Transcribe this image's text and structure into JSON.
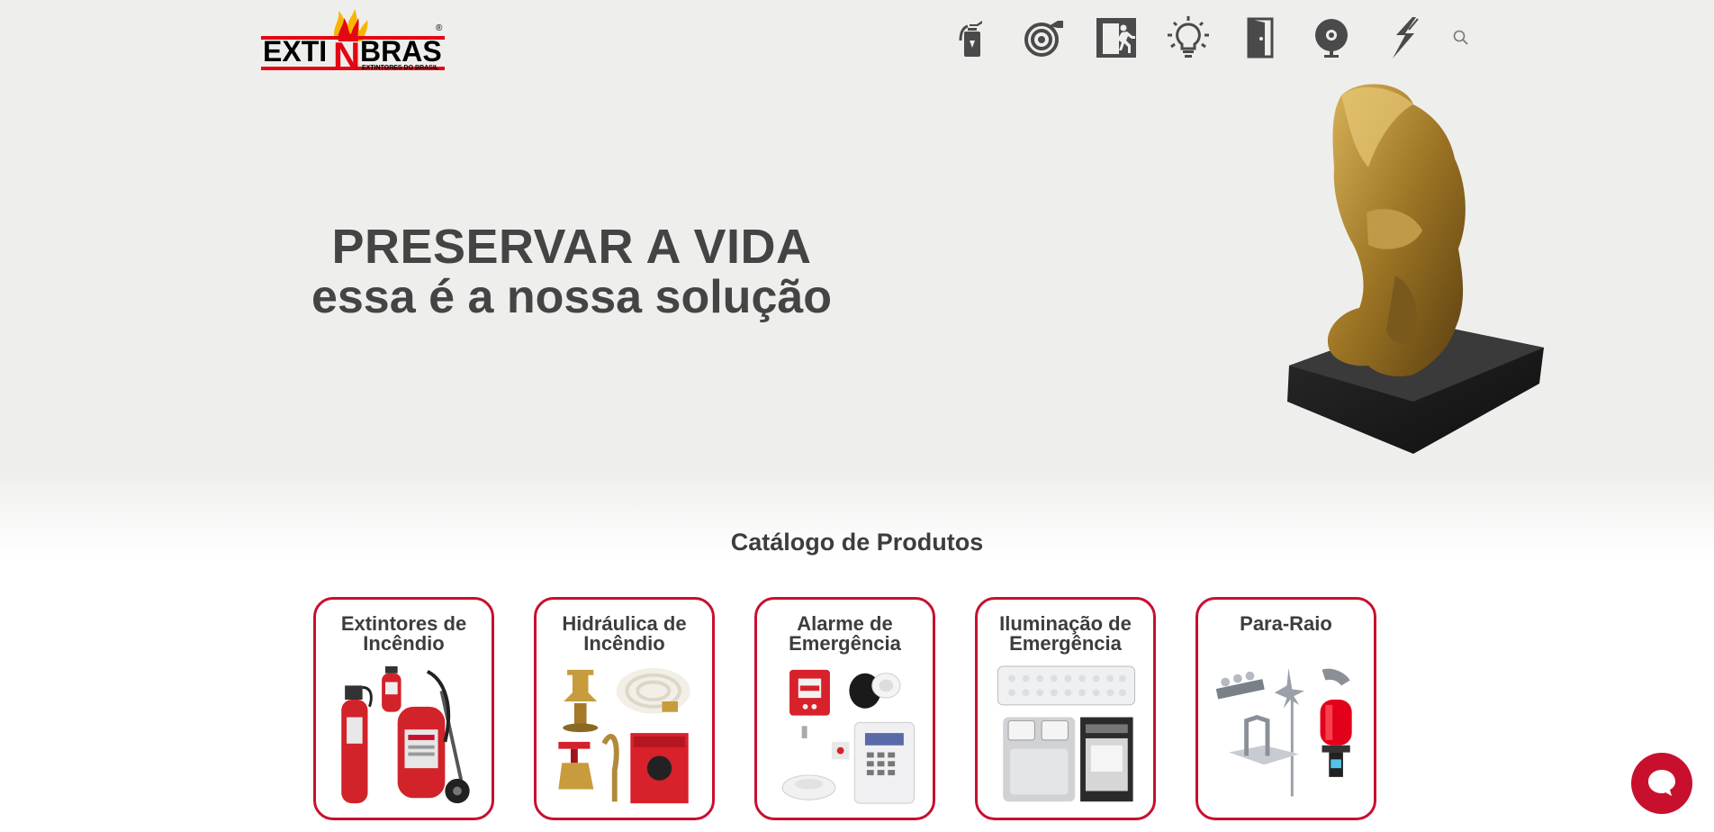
{
  "brand": {
    "logo_text_left": "EXTI",
    "logo_text_mid": "N",
    "logo_text_right": "BRAS",
    "logo_tagline": "EXTINTORES DO BRASIL",
    "registered": "®",
    "red": "#e30613",
    "black": "#000000"
  },
  "nav": {
    "items": [
      {
        "icon": "fire-extinguisher-icon"
      },
      {
        "icon": "fire-hose-icon"
      },
      {
        "icon": "emergency-exit-icon"
      },
      {
        "icon": "light-bulb-icon"
      },
      {
        "icon": "door-icon"
      },
      {
        "icon": "alarm-bell-icon"
      },
      {
        "icon": "lightning-icon"
      },
      {
        "icon": "search-icon"
      }
    ]
  },
  "hero": {
    "line1": "PRESERVAR A VIDA",
    "line2": "essa é a nossa solução"
  },
  "catalog": {
    "title": "Catálogo de Produtos",
    "cards": [
      {
        "title": "Extintores de Incêndio"
      },
      {
        "title": "Hidráulica de Incêndio"
      },
      {
        "title": "Alarme de Emergência"
      },
      {
        "title": "Iluminação de Emergência"
      },
      {
        "title": "Para-Raio"
      }
    ]
  },
  "colors": {
    "accent": "#c8102e",
    "text": "#444444",
    "hero_bg": "#eeefec"
  }
}
